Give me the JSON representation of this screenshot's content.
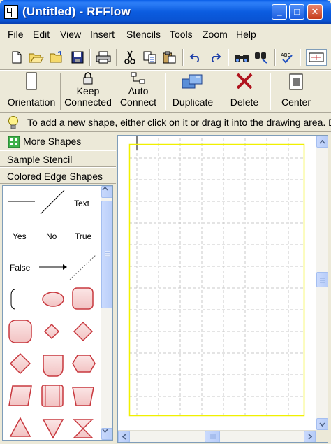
{
  "window": {
    "title": "(Untitled) - RFFlow",
    "controls": {
      "minimize": "_",
      "maximize": "□",
      "close": "✕"
    }
  },
  "menu": [
    "File",
    "Edit",
    "View",
    "Insert",
    "Stencils",
    "Tools",
    "Zoom",
    "Help"
  ],
  "toolbar_large": {
    "orientation": "Orientation",
    "keep_connected_1": "Keep",
    "keep_connected_2": "Connected",
    "auto_connect_1": "Auto",
    "auto_connect_2": "Connect",
    "duplicate": "Duplicate",
    "delete": "Delete",
    "center": "Center"
  },
  "hint": "To add a new shape, either click on it or drag it into the drawing area. D",
  "stencils": {
    "more_shapes": "More Shapes",
    "sample_stencil": "Sample Stencil",
    "colored_edge_shapes": "Colored Edge Shapes"
  },
  "palette": {
    "text_label": "Text",
    "yes_label": "Yes",
    "no_label": "No",
    "true_label": "True",
    "false_label": "False"
  },
  "colors": {
    "titlebar": "#0A54D4",
    "chrome": "#ECE9D8",
    "shape_fill": "#F9D6D6",
    "shape_edge": "#C8383E",
    "page_border": "#F0F000",
    "grid": "#C8C8C8"
  }
}
